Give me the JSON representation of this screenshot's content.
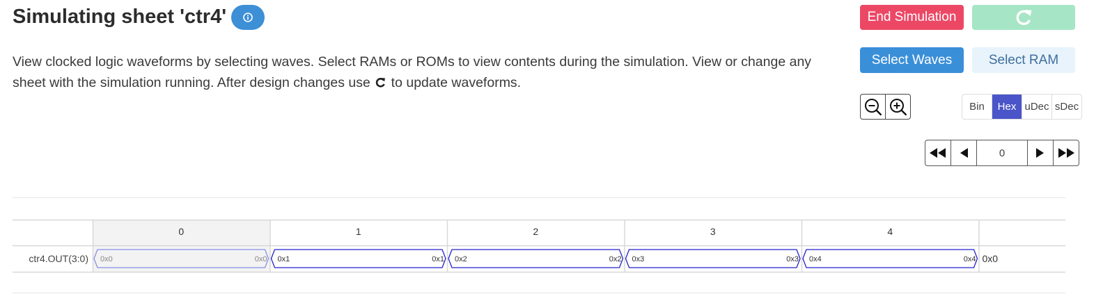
{
  "header": {
    "title": "Simulating sheet 'ctr4'",
    "info_icon": "info-circle-icon",
    "description_part1": "View clocked logic waveforms by selecting waves. Select RAMs or ROMs to view contents during the simulation. View or change any sheet with the simulation running. After design changes use",
    "description_part2": "to update waveforms.",
    "description_icon": "refresh-icon"
  },
  "buttons": {
    "end_simulation": "End Simulation",
    "refresh_icon": "refresh-icon",
    "select_waves": "Select Waves",
    "select_ram": "Select RAM",
    "zoom_out_icon": "zoom-out-icon",
    "zoom_in_icon": "zoom-in-icon"
  },
  "radix": {
    "options": [
      "Bin",
      "Hex",
      "uDec",
      "sDec"
    ],
    "selected": "Hex"
  },
  "navigation": {
    "first_icon": "fast-backward-icon",
    "prev_icon": "step-backward-icon",
    "clock_value": "0",
    "next_icon": "step-forward-icon",
    "last_icon": "fast-forward-icon"
  },
  "waveform": {
    "clock_ticks": [
      "0",
      "1",
      "2",
      "3",
      "4"
    ],
    "highlighted_tick": "0",
    "signals": [
      {
        "name": "ctr4.OUT(3:0)",
        "segments": [
          {
            "start": "0x0",
            "end": "0x0"
          },
          {
            "start": "0x1",
            "end": "0x1"
          },
          {
            "start": "0x2",
            "end": "0x2"
          },
          {
            "start": "0x3",
            "end": "0x3"
          },
          {
            "start": "0x4",
            "end": "0x4"
          }
        ],
        "current_value": "0x0"
      }
    ],
    "colors": {
      "wave_active": "#2222cc",
      "wave_highlight": "#8890e6",
      "highlight_bg": "#f3f3f3"
    }
  }
}
